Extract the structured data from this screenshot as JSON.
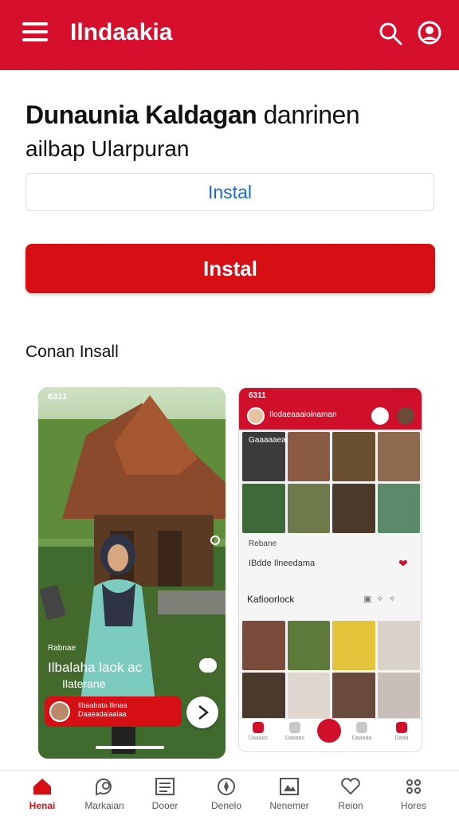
{
  "appbar": {
    "title": "Ilndaakia",
    "menu_icon": "menu-icon",
    "search_icon": "search-icon",
    "profile_icon": "profile-icon",
    "color": "#d50f2c"
  },
  "hero": {
    "title_bold": "Dunaunia Kaldagan",
    "title_light": "danrinen",
    "subtitle": "ailbap Ularpuran"
  },
  "buttons": {
    "outline_label": "Instal",
    "primary_label": "Instal",
    "primary_color": "#d50f14"
  },
  "screenshots": {
    "section_title": "Conan Insall",
    "shot1": {
      "status": "6311",
      "label": "Rabnae",
      "caption1": "Ilbalaha laok ac",
      "caption2": "Ilaterane",
      "pill_line1": "Ilbaabata Ilmaa",
      "pill_line2": "Daaeadaiaaiaa"
    },
    "shot2": {
      "status": "6311",
      "header_name": "Ilodaeaaaioinaman",
      "row1_label": "Gaaaaaea",
      "rebon": "Rebane",
      "sub_row": "IBdde Ilneedama",
      "section": "Kafioorlock",
      "nav": [
        "Daaaas",
        "Daaaas",
        "",
        "Daaaaa",
        "Daaa"
      ]
    }
  },
  "bottom_nav": [
    {
      "label": "Henai",
      "icon": "home-icon",
      "active": true
    },
    {
      "label": "Markaian",
      "icon": "chat-search-icon",
      "active": false
    },
    {
      "label": "Dooer",
      "icon": "news-icon",
      "active": false
    },
    {
      "label": "Denelo",
      "icon": "compass-icon",
      "active": false
    },
    {
      "label": "Nenemer",
      "icon": "image-icon",
      "active": false
    },
    {
      "label": "Reion",
      "icon": "heart-icon",
      "active": false
    },
    {
      "label": "Hores",
      "icon": "more-icon",
      "active": false
    }
  ]
}
